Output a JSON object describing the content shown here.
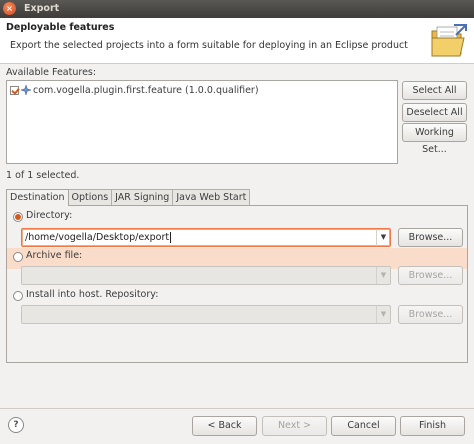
{
  "window": {
    "title": "Export",
    "close_label": "×"
  },
  "header": {
    "title": "Deployable features",
    "description": "Export the selected projects into a form suitable for deploying in an Eclipse product"
  },
  "features": {
    "label": "Available Features:",
    "items": [
      {
        "label": "com.vogella.plugin.first.feature (1.0.0.qualifier)",
        "checked": true
      }
    ],
    "selection_status": "1 of 1 selected."
  },
  "side_buttons": {
    "select_all": "Select All",
    "deselect_all": "Deselect All",
    "working_set": "Working Set..."
  },
  "tabs": [
    {
      "label": "Destination",
      "active": true
    },
    {
      "label": "Options",
      "active": false
    },
    {
      "label": "JAR Signing",
      "active": false
    },
    {
      "label": "Java Web Start",
      "active": false
    }
  ],
  "destination": {
    "directory_label": "Directory:",
    "directory_value": "/home/vogella/Desktop/export",
    "browse_label": "Browse...",
    "archive_label": "Archive file:",
    "install_label": "Install into host. Repository:"
  },
  "footer": {
    "back": "< Back",
    "next": "Next >",
    "cancel": "Cancel",
    "finish": "Finish",
    "help": "?"
  },
  "colors": {
    "accent": "#d35a1c",
    "highlight_row": "#f9dcc9",
    "focus_border": "#f07746"
  }
}
